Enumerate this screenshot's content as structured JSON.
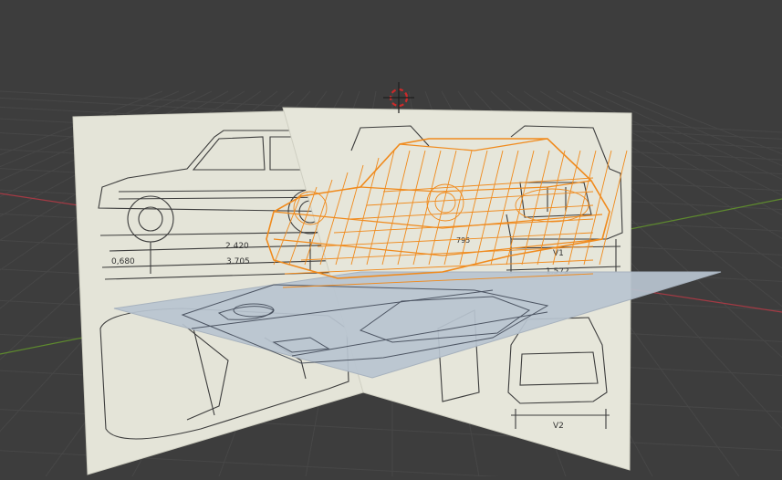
{
  "viewport": {
    "background": "#3d3d3d",
    "grid_color": "#474747",
    "x_axis_color": "#a33a44",
    "y_axis_color": "#5e8a2e",
    "selection_color": "#f08a1c",
    "cursor_color": "#cc2a2a"
  },
  "blueprint": {
    "paper_color": "#e4e4d8",
    "floor_color": "#b9c4d0",
    "dimensions": {
      "front_overhang": "0,680",
      "wheelbase": "2.420",
      "total_length": "3.705",
      "rear_overhang": "795",
      "v1": "V1",
      "track_width": "1.572",
      "v2": "V2"
    }
  },
  "objects": [
    {
      "name": "side-reference-plane"
    },
    {
      "name": "front-reference-plane"
    },
    {
      "name": "top-reference-plane"
    },
    {
      "name": "car-body-mesh",
      "state": "selected"
    },
    {
      "name": "3d-cursor"
    }
  ]
}
